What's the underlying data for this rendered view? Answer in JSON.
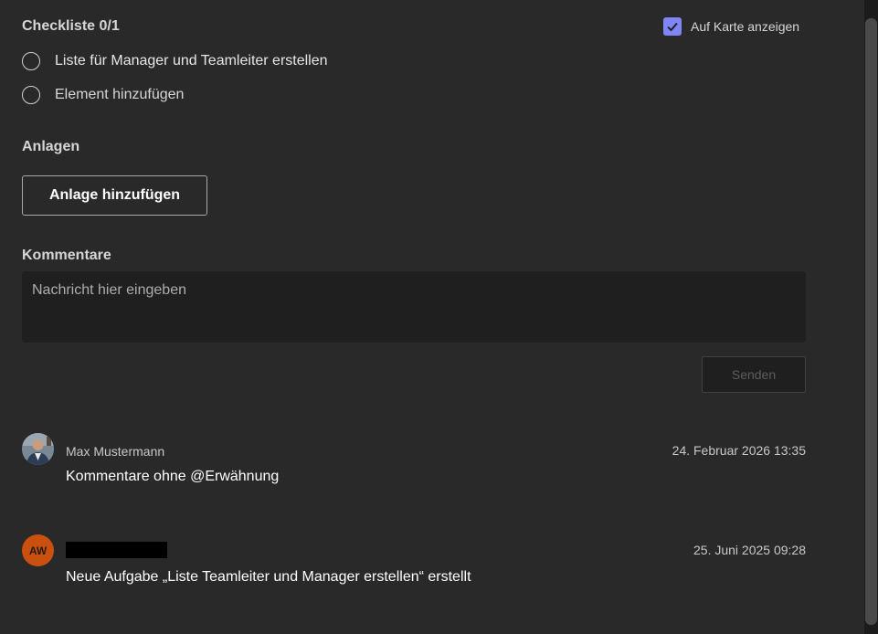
{
  "checklist": {
    "title": "Checkliste 0/1",
    "show_on_card_label": "Auf Karte anzeigen",
    "show_on_card_checked": true,
    "items": [
      {
        "label": "Liste für Manager und Teamleiter erstellen",
        "checked": false
      },
      {
        "placeholder": "Element hinzufügen"
      }
    ]
  },
  "attachments": {
    "title": "Anlagen",
    "add_button": "Anlage hinzufügen"
  },
  "comments": {
    "title": "Kommentare",
    "input_placeholder": "Nachricht hier eingeben",
    "send_button": "Senden",
    "entries": [
      {
        "author": "Max Mustermann",
        "timestamp": "24. Februar 2026 13:35",
        "text": "Kommentare ohne @Erwähnung",
        "avatar": "photo-avatar"
      },
      {
        "author": "",
        "author_redacted": true,
        "initials": "AW",
        "avatar_color": "#ca5010",
        "timestamp": "25. Juni 2025 09:28",
        "text": "Neue Aufgabe „Liste Teamleiter und Manager erstellen“ erstellt"
      }
    ]
  },
  "colors": {
    "background": "#292929",
    "accent": "#7f85f5",
    "input_bg": "#1f1f1f"
  }
}
